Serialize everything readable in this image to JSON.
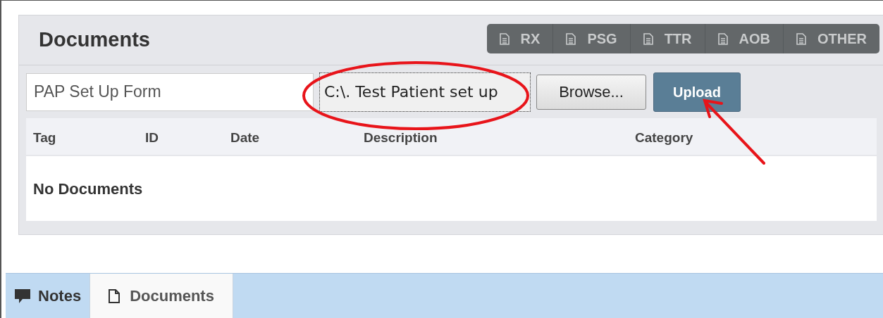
{
  "panel": {
    "title": "Documents",
    "category_buttons": [
      {
        "label": "RX"
      },
      {
        "label": "PSG"
      },
      {
        "label": "TTR"
      },
      {
        "label": "AOB"
      },
      {
        "label": "OTHER"
      }
    ],
    "upload_form": {
      "description_value": "PAP Set Up Form",
      "file_value": "C:\\. Test Patient set up",
      "browse_label": "Browse...",
      "upload_label": "Upload"
    },
    "table": {
      "columns": [
        "Tag",
        "ID",
        "Date",
        "Description",
        "Category"
      ],
      "empty_message": "No Documents"
    }
  },
  "bottom_tabs": [
    {
      "label": "Notes",
      "kind": "notes",
      "selected": false
    },
    {
      "label": "Documents",
      "kind": "documents",
      "selected": true
    }
  ]
}
